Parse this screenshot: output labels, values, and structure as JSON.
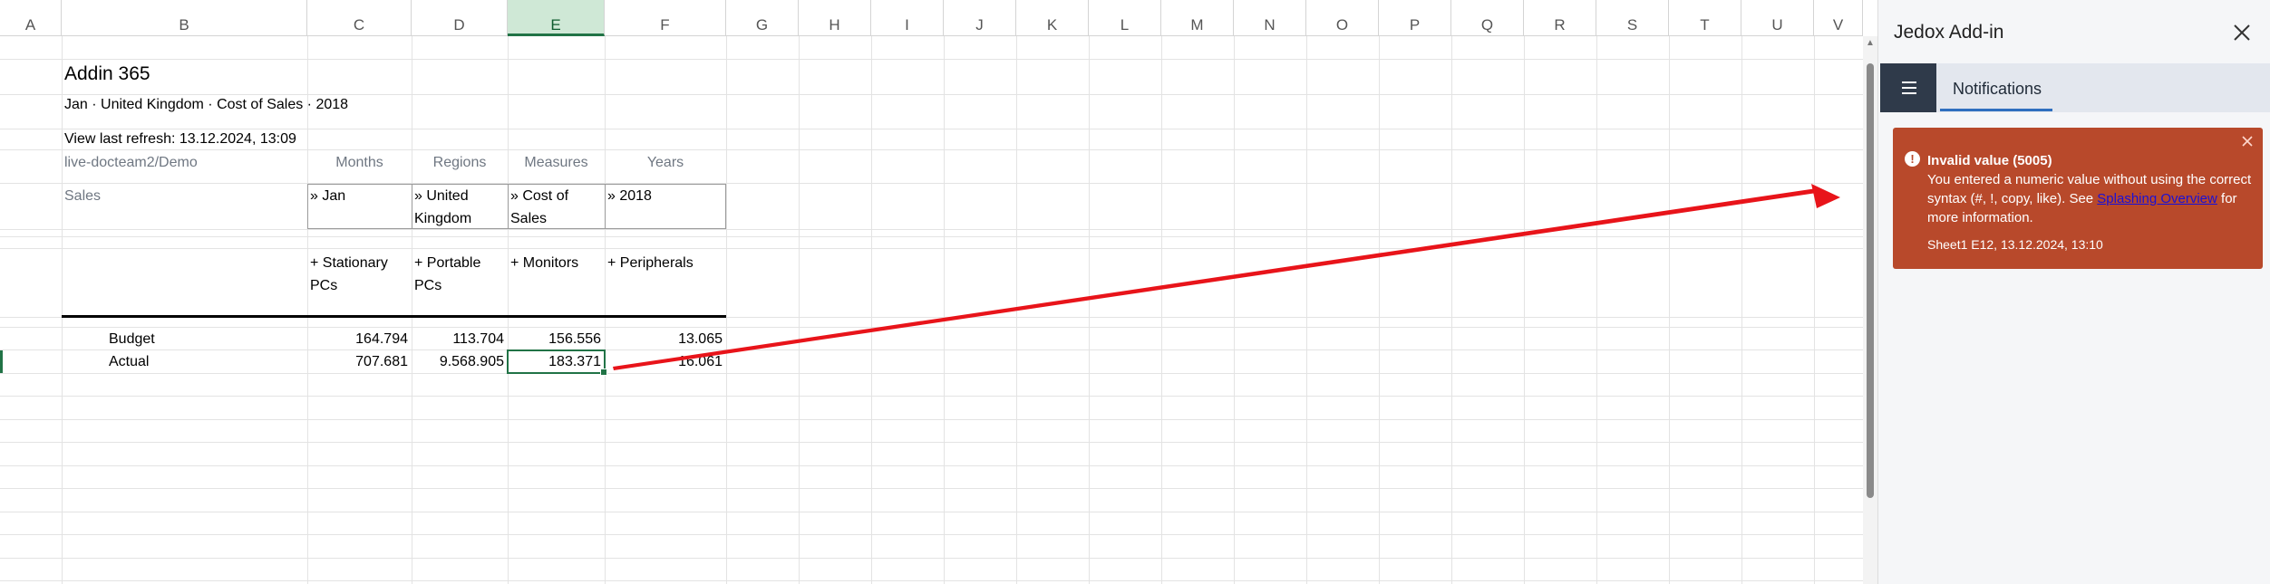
{
  "columns": [
    "A",
    "B",
    "C",
    "D",
    "E",
    "F",
    "G",
    "H",
    "I",
    "J",
    "K",
    "L",
    "M",
    "N",
    "O",
    "P",
    "Q",
    "R",
    "S",
    "T",
    "U",
    "V"
  ],
  "report": {
    "title": "Addin 365",
    "subtitle": "Jan · United Kingdom · Cost of Sales · 2018",
    "refresh": "View last refresh: 13.12.2024, 13:09",
    "connection": "live-docteam2/Demo",
    "dim_headers": [
      "Months",
      "Regions",
      "Measures",
      "Years"
    ],
    "cube_label": "Sales",
    "selectors": [
      {
        "line1": "» Jan",
        "line2": ""
      },
      {
        "line1": "» United",
        "line2": "Kingdom"
      },
      {
        "line1": "» Cost of",
        "line2": "Sales"
      },
      {
        "line1": "» 2018",
        "line2": ""
      }
    ],
    "products": [
      {
        "line1": "+ Stationary",
        "line2": "PCs"
      },
      {
        "line1": "+ Portable",
        "line2": "PCs"
      },
      {
        "line1": "+ Monitors",
        "line2": ""
      },
      {
        "line1": "+ Peripherals",
        "line2": ""
      }
    ],
    "rows": [
      {
        "label": "Budget",
        "values": [
          "164.794",
          "113.704",
          "156.556",
          "13.065"
        ]
      },
      {
        "label": "Actual",
        "values": [
          "707.681",
          "9.568.905",
          "183.371",
          "16.061"
        ]
      }
    ]
  },
  "pane": {
    "title": "Jedox Add-in",
    "tab_label": "Notifications",
    "notification": {
      "title": "Invalid value (5005)",
      "message_before": "You entered a numeric value without using the correct syntax (#, !, copy, like). See ",
      "link": "Splashing Overview",
      "message_after": " for more information.",
      "meta": "Sheet1 E12, 13.12.2024, 13:10"
    }
  },
  "colors": {
    "accent_green": "#217346",
    "notification_bg": "#b8492b",
    "arrow": "#e8141a",
    "menu_dark": "#2f3a4a"
  }
}
